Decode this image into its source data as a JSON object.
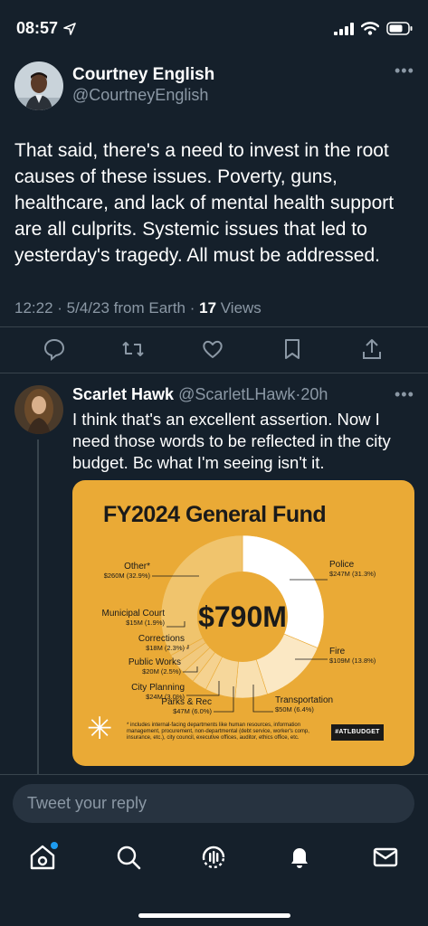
{
  "status": {
    "time": "08:57"
  },
  "main_tweet": {
    "author_name": "Courtney English",
    "author_handle": "@CourtneyEnglish",
    "text": "That said, there's a need to invest in the root causes of these issues. Poverty, guns, healthcare, and lack of mental health support are all culprits. Systemic issues that led to yesterday's tragedy. All must be addressed.",
    "meta_prefix": "12:22 · 5/4/23 from Earth · ",
    "views_count": "17",
    "views_label": " Views",
    "actions": [
      "reply-icon",
      "retweet-icon",
      "like-icon",
      "bookmark-icon",
      "share-icon"
    ]
  },
  "reply": {
    "author_name": "Scarlet Hawk",
    "author_handle": "@ScarletLHawk",
    "time": "·20h",
    "text": "I think that's an excellent assertion. Now I need those words to be reflected in the city budget. Bc what I'm seeing isn't it."
  },
  "chart_data": {
    "type": "pie",
    "title": "FY2024 General Fund",
    "center_label": "$790M",
    "slices": [
      {
        "name": "Police",
        "value_label": "$247M (31.3%)",
        "percent": 31.3,
        "color": "#ffffff"
      },
      {
        "name": "Fire",
        "value_label": "$109M (13.8%)",
        "percent": 13.8,
        "color": "#fbe8c4"
      },
      {
        "name": "Transportation",
        "value_label": "$50M (6.4%)",
        "percent": 6.4,
        "color": "#f9e0b0"
      },
      {
        "name": "Parks & Rec",
        "value_label": "$47M (6.0%)",
        "percent": 6.0,
        "color": "#f6d79b"
      },
      {
        "name": "City Planning",
        "value_label": "$24M (3.0%)",
        "percent": 3.0,
        "color": "#f5d290"
      },
      {
        "name": "Public Works",
        "value_label": "$20M (2.5%)",
        "percent": 2.5,
        "color": "#f3cd86"
      },
      {
        "name": "Corrections",
        "value_label": "$18M (2.3%)",
        "percent": 2.3,
        "color": "#f1c97e"
      },
      {
        "name": "Municipal Court",
        "value_label": "$15M (1.9%)",
        "percent": 1.9,
        "color": "#efc476"
      },
      {
        "name": "Other*",
        "value_label": "$260M (32.9%)",
        "percent": 32.9,
        "color": "#f0c46d"
      }
    ],
    "footnote": "* includes internal-facing departments like human resources, information management, procurement, non-departmental (debt service, worker's comp, insurance, etc.), city council, executive offices, auditor, ethics office, etc.",
    "hashtag": "#ATLBUDGET"
  },
  "compose": {
    "placeholder": "Tweet your reply"
  },
  "nav": {
    "items": [
      "home-icon",
      "search-icon",
      "spaces-icon",
      "notifications-icon",
      "messages-icon"
    ]
  }
}
